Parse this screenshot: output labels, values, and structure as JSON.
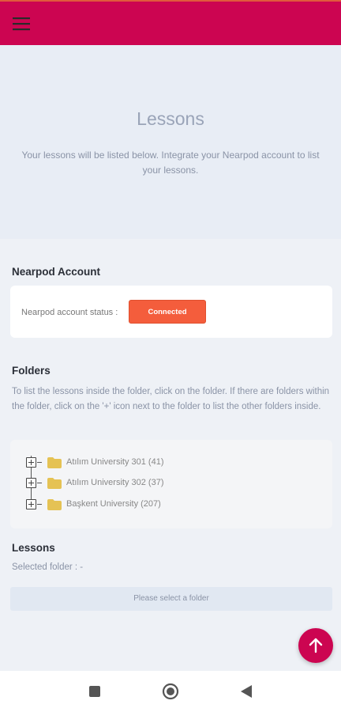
{
  "header": {
    "menu_icon": "menu-icon",
    "color": "#cc0551"
  },
  "hero": {
    "title": "Lessons",
    "description": "Your lessons will be listed below. Integrate your Nearpod account to list your lessons."
  },
  "nearpod": {
    "section_title": "Nearpod Account",
    "status_label": "Nearpod account status :",
    "status_button": "Connected",
    "status_color": "#f45d3c"
  },
  "folders": {
    "section_title": "Folders",
    "description": "To list the lessons inside the folder, click on the folder. If there are folders within the folder, click on the '+' icon next to the folder to list the other folders inside.",
    "items": [
      {
        "label": "Atılım University 301 (41)",
        "icon": "folder-icon",
        "expand_icon": "plus-box-icon"
      },
      {
        "label": "Atılım University 302 (37)",
        "icon": "folder-icon",
        "expand_icon": "plus-box-icon"
      },
      {
        "label": "Başkent University (207)",
        "icon": "folder-icon",
        "expand_icon": "plus-box-icon"
      }
    ]
  },
  "lessons": {
    "section_title": "Lessons",
    "selected_folder": "Selected folder : -",
    "placeholder": "Please select a folder"
  },
  "fab": {
    "icon": "arrow-up-icon"
  },
  "system_nav": {
    "icons": [
      "square-icon",
      "circle-home-icon",
      "triangle-back-icon"
    ]
  }
}
